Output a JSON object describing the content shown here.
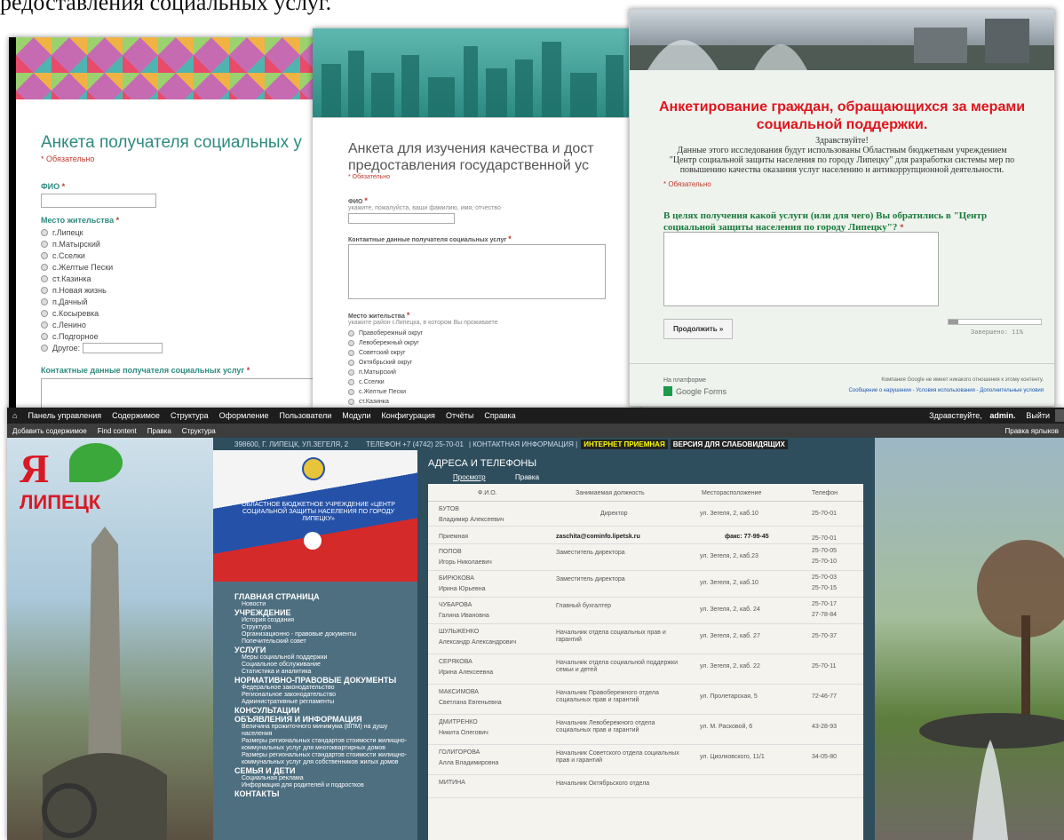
{
  "caption": "редоставления социальных услуг.",
  "form1": {
    "title": "Анкета получателя социальных у",
    "required": "* Обязательно",
    "fio": "ФИО",
    "fio_star": "*",
    "place": "Место жительства",
    "place_star": "*",
    "places": [
      "г.Липецк",
      "п.Матырский",
      "с.Сселки",
      "с.Желтые Пески",
      "ст.Казинка",
      "п.Новая жизнь",
      "п.Дачный",
      "с.Косыревка",
      "с.Ленино",
      "с.Подгорное"
    ],
    "other": "Другое:",
    "contact": "Контактные данные получателя социальных услуг",
    "contact_star": "*"
  },
  "form2": {
    "title1": "Анкета для изучения качества и дост",
    "title2": "предоставления государственной ус",
    "required": "* Обязательно",
    "fio": "ФИО",
    "fio_star": "*",
    "fio_hint": "укажите, пожалуйста, ваши фамилию, имя, отчество",
    "contact": "Контактные данные получателя социальных услуг",
    "contact_star": "*",
    "place": "Место жительства",
    "place_star": "*",
    "place_hint": "укажите район г.Липецка, в котором Вы проживаете",
    "places": [
      "Правобережный округ",
      "Левобережный округ",
      "Советский округ",
      "Октябрьский округ",
      "п.Матырский",
      "с.Сселки",
      "с.Желтые Пески",
      "ст.Казинка"
    ]
  },
  "form3": {
    "title1": "Анкетирование граждан, обращающихся за мерами",
    "title2": "социальной поддержки.",
    "hello": "Здравствуйте!",
    "intro1": "Данные этого исследования будут использованы Областным бюджетным учреждением",
    "intro2": "\"Центр социальной защиты населения по городу Липецку\" для разработки системы мер по",
    "intro3": "повышению качества оказания услуг населению и антикоррупционной деятельности.",
    "required": "* Обязательно",
    "q1": "В целях получения какой услуги (или для чего) Вы обратились в \"Центр",
    "q2": "социальной защиты населения по городу Липецку\"?",
    "q_star": "*",
    "continue": "Продолжить »",
    "progress_label": "Завершено: 11%",
    "progress": 0.11,
    "platform": "На платформе",
    "gforms": "Google Forms",
    "disclaimer": "Компания Google не имеет никакого отношения к этому контенту.",
    "links": "Сообщение о нарушении - Условия использования - Дополнительные условия"
  },
  "cms": {
    "toolbar": [
      "Панель управления",
      "Содержимое",
      "Структура",
      "Оформление",
      "Пользователи",
      "Модули",
      "Конфигурация",
      "Отчёты",
      "Справка"
    ],
    "greeting_pre": "Здравствуйте,",
    "greeting_user": "admin.",
    "logout": "Выйти",
    "shortcuts": [
      "Добавить содержимое",
      "Find content",
      "Правка",
      "Структура"
    ],
    "edit_shortcuts": "Правка ярлыков",
    "address": "398600, Г. ЛИПЕЦК, УЛ.ЗЕГЕЛЯ, 2",
    "phone": "ТЕЛЕФОН +7 (4742) 25-70-01",
    "contact_info": "| КОНТАКТНАЯ ИНФОРМАЦИЯ |",
    "reception": "ИНТЕРНЕТ ПРИЕМНАЯ",
    "low_vision": "ВЕРСИЯ ДЛЯ СЛАБОВИДЯЩИХ",
    "logo_text": "ЛИПЕЦК",
    "logo_letter": "Я",
    "org": "ОБЛАСТНОЕ БЮДЖЕТНОЕ УЧРЕЖДЕНИЕ «ЦЕНТР СОЦИАЛЬНОЙ ЗАЩИТЫ НАСЕЛЕНИЯ ПО ГОРОДУ ЛИПЕЦКУ»",
    "nav": [
      {
        "h": "ГЛАВНАЯ СТРАНИЦА",
        "items": [
          "Новости"
        ]
      },
      {
        "h": "УЧРЕЖДЕНИЕ",
        "items": [
          "История создания",
          "Структура",
          "Организационно - правовые документы",
          "Попечительский совет"
        ]
      },
      {
        "h": "УСЛУГИ",
        "items": [
          "Меры социальной поддержки",
          "Социальное обслуживание",
          "Статистика и аналитика"
        ]
      },
      {
        "h": "НОРМАТИВНО-ПРАВОВЫЕ ДОКУМЕНТЫ",
        "items": [
          "Федеральное законодательство",
          "Региональное законодательство",
          "Административные регламенты"
        ]
      },
      {
        "h": "КОНСУЛЬТАЦИИ",
        "items": []
      },
      {
        "h": "ОБЪЯВЛЕНИЯ И ИНФОРМАЦИЯ",
        "items": [
          "Величина прожиточного минимума (ВПМ) на душу населения",
          "Размеры региональных стандартов стоимости жилищно-коммунальных услуг для многоквартирных домов",
          "Размеры региональных стандартов стоимости жилищно-коммунальных услуг для собственников жилых домов"
        ]
      },
      {
        "h": "СЕМЬЯ И ДЕТИ",
        "items": [
          "Социальная реклама",
          "Информация для родителей и подростков"
        ]
      },
      {
        "h": "КОНТАКТЫ",
        "items": []
      }
    ],
    "page_title": "АДРЕСА И ТЕЛЕФОНЫ",
    "tab_view": "Просмотр",
    "tab_edit": "Правка",
    "cols": [
      "Ф.И.О.",
      "Занимаемая должность",
      "Месторасположение",
      "Телефон"
    ],
    "rows": [
      {
        "n1": "БУТОВ",
        "n2": "Владимир Алексеевич",
        "pos": "Директор",
        "loc": "ул. Зегеля, 2, каб.10",
        "ph": [
          "25-70-01"
        ]
      },
      {
        "n1": "Приемная",
        "n2": "",
        "pos": "zaschita@cominfo.lipetsk.ru",
        "loc": "факс: 77-99-45",
        "ph": [
          "25-70-01"
        ]
      },
      {
        "n1": "ПОПОВ",
        "n2": "Игорь Николаевич",
        "pos": "Заместитель директора",
        "loc": "ул. Зегеля, 2, каб.23",
        "ph": [
          "25-70-05",
          "25-70-10"
        ]
      },
      {
        "n1": "БИРЮКОВА",
        "n2": "Ирина Юрьевна",
        "pos": "Заместитель директора",
        "loc": "ул. Зегеля, 2, каб.10",
        "ph": [
          "25-70-03",
          "25-70-15"
        ]
      },
      {
        "n1": "ЧУБАРОВА",
        "n2": "Галина Ивановна",
        "pos": "Главный бухгалтер",
        "loc": "ул. Зегеля, 2, каб. 24",
        "ph": [
          "25-70-17",
          "27-78-84"
        ]
      },
      {
        "n1": "ШУЛЬЖЕНКО",
        "n2": "Александр Александрович",
        "pos": "Начальник отдела социальных прав и гарантий",
        "loc": "ул. Зегеля, 2, каб. 27",
        "ph": [
          "25-70-37"
        ]
      },
      {
        "n1": "СЕРЯКОВА",
        "n2": "Ирина Алексеевна",
        "pos": "Начальник отдела социальной поддержки семьи и детей",
        "loc": "ул. Зегеля, 2, каб. 22",
        "ph": [
          "25-70-11"
        ]
      },
      {
        "n1": "МАКСИМОВА",
        "n2": "Светлана Евгеньевна",
        "pos": "Начальник Правобережного отдела социальных прав и гарантий",
        "loc": "ул. Пролетарская, 5",
        "ph": [
          "72-46-77"
        ]
      },
      {
        "n1": "ДМИТРЕНКО",
        "n2": "Никита Олегович",
        "pos": "Начальник Левобережного отдела социальных прав и гарантий",
        "loc": "ул. М. Расковой, 6",
        "ph": [
          "43-28-93"
        ]
      },
      {
        "n1": "ГОЛИГОРОВА",
        "n2": "Алла Владимировна",
        "pos": "Начальник Советского отдела социальных прав и гарантий",
        "loc": "ул. Циолковского, 11/1",
        "ph": [
          "34-05-80"
        ]
      },
      {
        "n1": "МИТИНА",
        "n2": "",
        "pos": "Начальник Октябрьского отдела",
        "loc": "",
        "ph": []
      }
    ]
  }
}
